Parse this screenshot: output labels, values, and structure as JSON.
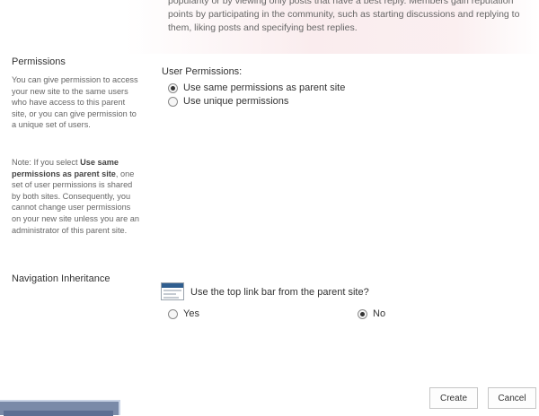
{
  "intro": {
    "lines": [
      "popularity or by viewing only posts that have a best reply. Members gain reputation",
      "points by participating in the community, such as starting discussions and replying to",
      "them, liking posts and specifying best replies."
    ]
  },
  "permissions": {
    "title": "Permissions",
    "description": "You can give permission to access your new site to the same users who have access to this parent site, or you can give permission to a unique set of users.",
    "note_prefix": "Note: If you select ",
    "note_bold": "Use same permissions as parent site",
    "note_suffix": ", one set of user permissions is shared by both sites. Consequently, you cannot change user permissions on your new site unless you are an administrator of this parent site.",
    "field_label": "User Permissions:",
    "options": [
      {
        "label": "Use same permissions as parent site",
        "selected": true
      },
      {
        "label": "Use unique permissions",
        "selected": false
      }
    ]
  },
  "navigation": {
    "title": "Navigation Inheritance",
    "question": "Use the top link bar from the parent site?",
    "icon": "top-link-bar-icon",
    "options": [
      {
        "label": "Yes",
        "selected": false
      },
      {
        "label": "No",
        "selected": true
      }
    ]
  },
  "buttons": {
    "create": "Create",
    "cancel": "Cancel"
  }
}
